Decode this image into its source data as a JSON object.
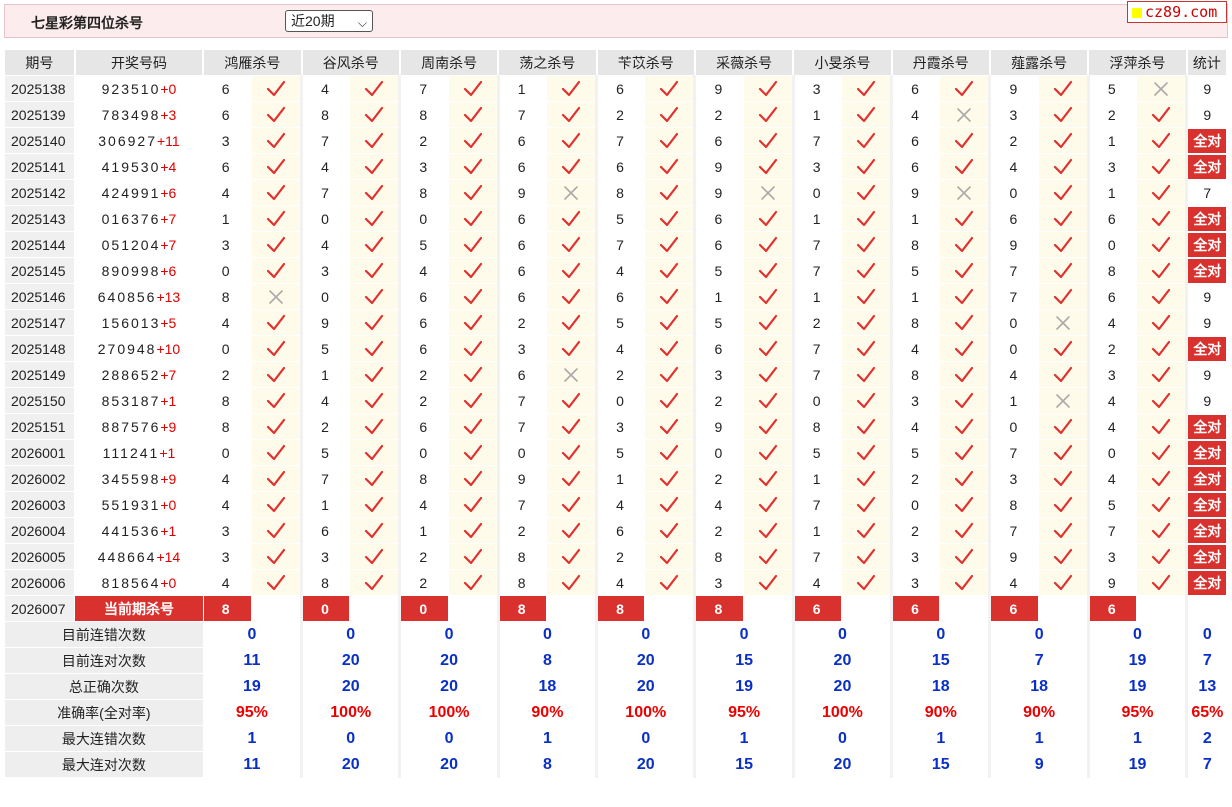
{
  "header": {
    "title": "七星彩第四位杀号",
    "period_selected": "近20期",
    "brand": "cz89.com"
  },
  "columns": {
    "issue": "期号",
    "numbers": "开奖号码",
    "stat": "统计",
    "experts": [
      "鸿雁杀号",
      "谷风杀号",
      "周南杀号",
      "荡之杀号",
      "苄苡杀号",
      "采薇杀号",
      "小旻杀号",
      "丹霞杀号",
      "薤露杀号",
      "浮萍杀号"
    ]
  },
  "all_right_label": "全对",
  "rows": [
    {
      "issue": "2025138",
      "nums": "923510",
      "extra": "+0",
      "kills": [
        "6",
        "4",
        "7",
        "1",
        "6",
        "9",
        "3",
        "6",
        "9",
        "5"
      ],
      "hits": [
        1,
        1,
        1,
        1,
        1,
        1,
        1,
        1,
        1,
        0
      ],
      "stat": "9"
    },
    {
      "issue": "2025139",
      "nums": "783498",
      "extra": "+3",
      "kills": [
        "6",
        "8",
        "8",
        "7",
        "2",
        "2",
        "1",
        "4",
        "3",
        "2"
      ],
      "hits": [
        1,
        1,
        1,
        1,
        1,
        1,
        1,
        0,
        1,
        1
      ],
      "stat": "9"
    },
    {
      "issue": "2025140",
      "nums": "306927",
      "extra": "+11",
      "kills": [
        "3",
        "7",
        "2",
        "6",
        "7",
        "6",
        "7",
        "6",
        "2",
        "1"
      ],
      "hits": [
        1,
        1,
        1,
        1,
        1,
        1,
        1,
        1,
        1,
        1
      ],
      "stat": "全对"
    },
    {
      "issue": "2025141",
      "nums": "419530",
      "extra": "+4",
      "kills": [
        "6",
        "4",
        "3",
        "6",
        "6",
        "9",
        "3",
        "6",
        "4",
        "3"
      ],
      "hits": [
        1,
        1,
        1,
        1,
        1,
        1,
        1,
        1,
        1,
        1
      ],
      "stat": "全对"
    },
    {
      "issue": "2025142",
      "nums": "424991",
      "extra": "+6",
      "kills": [
        "4",
        "7",
        "8",
        "9",
        "8",
        "9",
        "0",
        "9",
        "0",
        "1"
      ],
      "hits": [
        1,
        1,
        1,
        0,
        1,
        0,
        1,
        0,
        1,
        1
      ],
      "stat": "7"
    },
    {
      "issue": "2025143",
      "nums": "016376",
      "extra": "+7",
      "kills": [
        "1",
        "0",
        "0",
        "6",
        "5",
        "6",
        "1",
        "1",
        "6",
        "6"
      ],
      "hits": [
        1,
        1,
        1,
        1,
        1,
        1,
        1,
        1,
        1,
        1
      ],
      "stat": "全对"
    },
    {
      "issue": "2025144",
      "nums": "051204",
      "extra": "+7",
      "kills": [
        "3",
        "4",
        "5",
        "6",
        "7",
        "6",
        "7",
        "8",
        "9",
        "0"
      ],
      "hits": [
        1,
        1,
        1,
        1,
        1,
        1,
        1,
        1,
        1,
        1
      ],
      "stat": "全对"
    },
    {
      "issue": "2025145",
      "nums": "890998",
      "extra": "+6",
      "kills": [
        "0",
        "3",
        "4",
        "6",
        "4",
        "5",
        "7",
        "5",
        "7",
        "8"
      ],
      "hits": [
        1,
        1,
        1,
        1,
        1,
        1,
        1,
        1,
        1,
        1
      ],
      "stat": "全对"
    },
    {
      "issue": "2025146",
      "nums": "640856",
      "extra": "+13",
      "kills": [
        "8",
        "0",
        "6",
        "6",
        "6",
        "1",
        "1",
        "1",
        "7",
        "6"
      ],
      "hits": [
        0,
        1,
        1,
        1,
        1,
        1,
        1,
        1,
        1,
        1
      ],
      "stat": "9"
    },
    {
      "issue": "2025147",
      "nums": "156013",
      "extra": "+5",
      "kills": [
        "4",
        "9",
        "6",
        "2",
        "5",
        "5",
        "2",
        "8",
        "0",
        "4"
      ],
      "hits": [
        1,
        1,
        1,
        1,
        1,
        1,
        1,
        1,
        0,
        1
      ],
      "stat": "9"
    },
    {
      "issue": "2025148",
      "nums": "270948",
      "extra": "+10",
      "kills": [
        "0",
        "5",
        "6",
        "3",
        "4",
        "6",
        "7",
        "4",
        "0",
        "2"
      ],
      "hits": [
        1,
        1,
        1,
        1,
        1,
        1,
        1,
        1,
        1,
        1
      ],
      "stat": "全对"
    },
    {
      "issue": "2025149",
      "nums": "288652",
      "extra": "+7",
      "kills": [
        "2",
        "1",
        "2",
        "6",
        "2",
        "3",
        "7",
        "8",
        "4",
        "3"
      ],
      "hits": [
        1,
        1,
        1,
        0,
        1,
        1,
        1,
        1,
        1,
        1
      ],
      "stat": "9"
    },
    {
      "issue": "2025150",
      "nums": "853187",
      "extra": "+1",
      "kills": [
        "8",
        "4",
        "2",
        "7",
        "0",
        "2",
        "0",
        "3",
        "1",
        "4"
      ],
      "hits": [
        1,
        1,
        1,
        1,
        1,
        1,
        1,
        1,
        0,
        1
      ],
      "stat": "9"
    },
    {
      "issue": "2025151",
      "nums": "887576",
      "extra": "+9",
      "kills": [
        "8",
        "2",
        "6",
        "7",
        "3",
        "9",
        "8",
        "4",
        "0",
        "4"
      ],
      "hits": [
        1,
        1,
        1,
        1,
        1,
        1,
        1,
        1,
        1,
        1
      ],
      "stat": "全对"
    },
    {
      "issue": "2026001",
      "nums": "111241",
      "extra": "+1",
      "kills": [
        "0",
        "5",
        "0",
        "0",
        "5",
        "0",
        "5",
        "5",
        "7",
        "0"
      ],
      "hits": [
        1,
        1,
        1,
        1,
        1,
        1,
        1,
        1,
        1,
        1
      ],
      "stat": "全对"
    },
    {
      "issue": "2026002",
      "nums": "345598",
      "extra": "+9",
      "kills": [
        "4",
        "7",
        "8",
        "9",
        "1",
        "2",
        "1",
        "2",
        "3",
        "4"
      ],
      "hits": [
        1,
        1,
        1,
        1,
        1,
        1,
        1,
        1,
        1,
        1
      ],
      "stat": "全对"
    },
    {
      "issue": "2026003",
      "nums": "551931",
      "extra": "+0",
      "kills": [
        "4",
        "1",
        "4",
        "7",
        "4",
        "4",
        "7",
        "0",
        "8",
        "5"
      ],
      "hits": [
        1,
        1,
        1,
        1,
        1,
        1,
        1,
        1,
        1,
        1
      ],
      "stat": "全对"
    },
    {
      "issue": "2026004",
      "nums": "441536",
      "extra": "+1",
      "kills": [
        "3",
        "6",
        "1",
        "2",
        "6",
        "2",
        "1",
        "2",
        "7",
        "7"
      ],
      "hits": [
        1,
        1,
        1,
        1,
        1,
        1,
        1,
        1,
        1,
        1
      ],
      "stat": "全对"
    },
    {
      "issue": "2026005",
      "nums": "448664",
      "extra": "+14",
      "kills": [
        "3",
        "3",
        "2",
        "8",
        "2",
        "8",
        "7",
        "3",
        "9",
        "3"
      ],
      "hits": [
        1,
        1,
        1,
        1,
        1,
        1,
        1,
        1,
        1,
        1
      ],
      "stat": "全对"
    },
    {
      "issue": "2026006",
      "nums": "818564",
      "extra": "+0",
      "kills": [
        "4",
        "8",
        "2",
        "8",
        "4",
        "3",
        "4",
        "3",
        "4",
        "9"
      ],
      "hits": [
        1,
        1,
        1,
        1,
        1,
        1,
        1,
        1,
        1,
        1
      ],
      "stat": "全对"
    }
  ],
  "current": {
    "issue": "2026007",
    "label": "当前期杀号",
    "kills": [
      "8",
      "0",
      "0",
      "8",
      "8",
      "8",
      "6",
      "6",
      "6",
      "6"
    ]
  },
  "summary": [
    {
      "label": "目前连错次数",
      "values": [
        "0",
        "0",
        "0",
        "0",
        "0",
        "0",
        "0",
        "0",
        "0",
        "0"
      ],
      "stat": "0",
      "red": false
    },
    {
      "label": "目前连对次数",
      "values": [
        "11",
        "20",
        "20",
        "8",
        "20",
        "15",
        "20",
        "15",
        "7",
        "19"
      ],
      "stat": "7",
      "red": false
    },
    {
      "label": "总正确次数",
      "values": [
        "19",
        "20",
        "20",
        "18",
        "20",
        "19",
        "20",
        "18",
        "18",
        "19"
      ],
      "stat": "13",
      "red": false
    },
    {
      "label": "准确率(全对率)",
      "values": [
        "95%",
        "100%",
        "100%",
        "90%",
        "100%",
        "95%",
        "100%",
        "90%",
        "90%",
        "95%"
      ],
      "stat": "65%",
      "red": true
    },
    {
      "label": "最大连错次数",
      "values": [
        "1",
        "0",
        "0",
        "1",
        "0",
        "1",
        "0",
        "1",
        "1",
        "1"
      ],
      "stat": "2",
      "red": false
    },
    {
      "label": "最大连对次数",
      "values": [
        "11",
        "20",
        "20",
        "8",
        "20",
        "15",
        "20",
        "15",
        "9",
        "19"
      ],
      "stat": "7",
      "red": false
    }
  ],
  "colors": {
    "accent_red": "#d9312d",
    "check_red": "#e0312f",
    "cross_gray": "#aaaaaa",
    "value_blue": "#0a2fc6",
    "header_pink": "#fdecee"
  },
  "icons": {
    "hit": "check-icon",
    "miss": "cross-icon"
  }
}
